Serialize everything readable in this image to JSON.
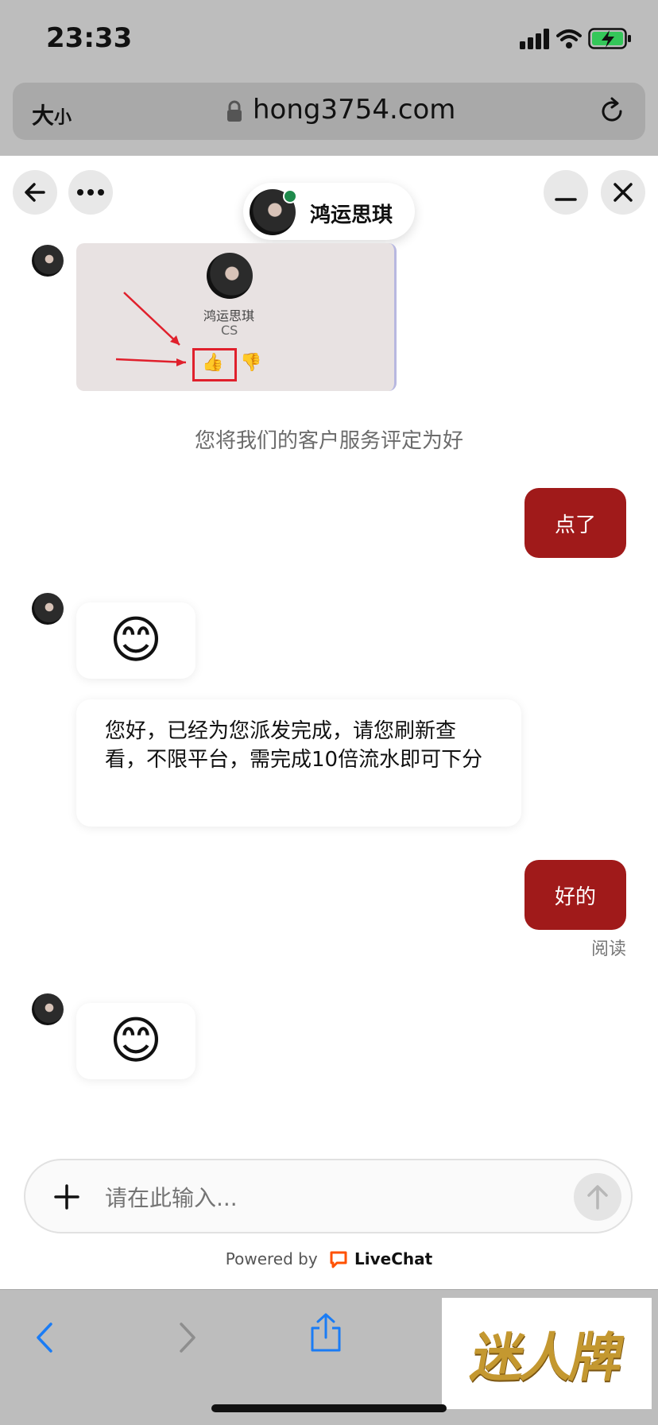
{
  "status_bar": {
    "time": "23:33"
  },
  "browser": {
    "aa_big": "大",
    "aa_small": "小",
    "domain": "hong3754.com"
  },
  "header": {
    "agent_name": "鸿运思琪"
  },
  "messages": {
    "image_card": {
      "agent_name": "鸿运思琪",
      "role": "CS"
    },
    "system_note": "您将我们的客户服务评定为好",
    "out_1": "点了",
    "in_emoji_1": "😊",
    "in_text_1": "您好，已经为您派发完成，请您刷新查看，不限平台，需完成10倍流水即可下分",
    "out_2": "好的",
    "read_status": "阅读",
    "in_emoji_2": "😊"
  },
  "composer": {
    "placeholder": "请在此输入..."
  },
  "footer": {
    "powered_by": "Powered by",
    "brand": "LiveChat"
  },
  "watermark": {
    "text": "迷人牌"
  },
  "colors": {
    "outgoing_bubble": "#a01a1a",
    "online_dot": "#1f8a4c",
    "browser_chrome": "#bdbdbd",
    "ios_blue": "#1a7cf5"
  }
}
